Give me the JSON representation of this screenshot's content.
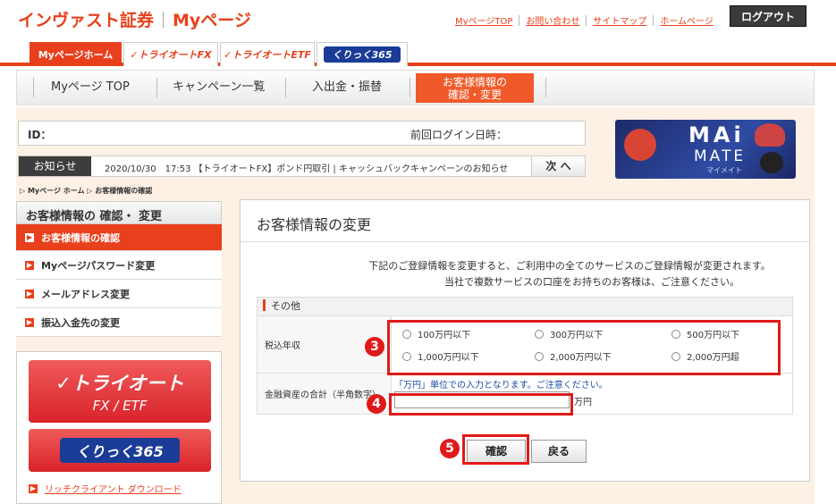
{
  "header": {
    "brand": "インヴァスト証券",
    "brand_sub": "Myページ",
    "links": [
      "MyページTOP",
      "お問い合わせ",
      "サイトマップ",
      "ホームページ"
    ],
    "logout": "ログアウト"
  },
  "product_tabs": {
    "home": "Myページホーム",
    "fx": "トライオートFX",
    "etf": "トライオートETF",
    "k365": "くりっく365"
  },
  "gnav": {
    "items": [
      "Myページ TOP",
      "キャンペーン一覧",
      "入出金・振替"
    ],
    "active_line1": "お客様情報の",
    "active_line2": "確認・変更"
  },
  "info": {
    "id_label": "ID：",
    "last_login_label": "前回ログイン日時："
  },
  "news": {
    "badge": "お知らせ",
    "text": "2020/10/30　17:53 【トライオートFX】ポンド円取引 | キャッシュバックキャンペーンのお知らせ",
    "next": "次 へ"
  },
  "banner": {
    "mai": "MAi",
    "mate": "MATE",
    "kana": "マイメイト"
  },
  "breadcrumb": "▷ Myページ ホーム ▷ お客様情報の確認",
  "left_menu": {
    "heading": "お客様情報の 確認・ 変更",
    "items": [
      "お客様情報の確認",
      "Myページパスワード変更",
      "メールアドレス変更",
      "振込入金先の変更"
    ]
  },
  "promo": {
    "b1_line1": "トライオート",
    "b1_line2": "FX / ETF",
    "b2": "くりっく365",
    "download": "リッチクライアント ダウンロード"
  },
  "main": {
    "title": "お客様情報の変更",
    "notice1": "下記のご登録情報を変更すると、ご利用中の全てのサービスのご登録情報が変更されます。",
    "notice2": "当社で複数サービスの口座をお持ちのお客様は、ご注意ください。",
    "section": "その他",
    "income_label": "税込年収",
    "income_options": [
      "100万円以下",
      "300万円以下",
      "500万円以下",
      "1,000万円以下",
      "2,000万円以下",
      "2,000万円超"
    ],
    "assets_label": "金融資産の合計（半角数字）",
    "assets_hint": "「万円」単位での入力となります。ご注意ください。",
    "assets_value": "",
    "assets_unit": "万円",
    "confirm": "確認",
    "back": "戻る"
  },
  "markers": [
    "3",
    "4",
    "5"
  ],
  "colors": {
    "brand": "#e8401c",
    "annotation": "#e01a1a",
    "k365": "#1a3c96"
  }
}
